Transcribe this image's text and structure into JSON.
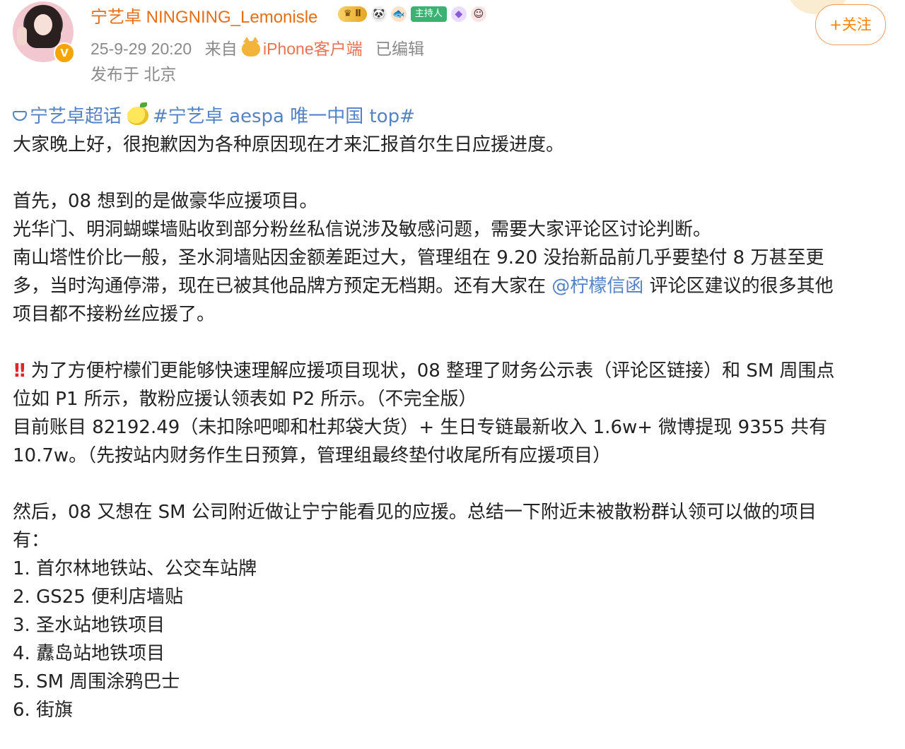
{
  "author": {
    "name": "宁艺卓 NINGNING_Lemonisle",
    "badges": {
      "crown_level": "Ⅱ",
      "host_label": "主持人"
    }
  },
  "post_meta": {
    "timestamp": "25-9-29 20:20",
    "source_prefix": "来自",
    "client": "iPhone客户端",
    "edited": "已编辑",
    "location": "发布于 北京"
  },
  "follow_button": {
    "label": "+关注"
  },
  "content": {
    "topic_super": "宁艺卓超话",
    "topic_tag": "#宁艺卓 aespa 唯一中国 top#",
    "line_1": "大家晚上好，很抱歉因为各种原因现在才来汇报首尔生日应援进度。",
    "para_2_line_1": "首先，08 想到的是做豪华应援项目。",
    "para_2_line_2": "光华门、明洞蝴蝶墙贴收到部分粉丝私信说涉及敏感问题，需要大家评论区讨论判断。",
    "para_2_line_3": "南山塔性价比一般，圣水洞墙贴因金额差距过大，管理组在 9.20 没抬新品前几乎要垫付 8 万甚至更",
    "para_2_line_4_a": "多，当时沟通停滞，现在已被其他品牌方预定无档期。还有大家在",
    "mention": "@柠檬信函",
    "para_2_line_4_b": "评论区建议的很多其他",
    "para_2_line_5": "项目都不接粉丝应援了。",
    "para_3_line_1": "为了方便柠檬们更能够快速理解应援项目现状，08 整理了财务公示表（评论区链接）和 SM 周围点",
    "para_3_line_2": "位如 P1 所示，散粉应援认领表如 P2 所示。（不完全版）",
    "para_3_line_3": "目前账目 82192.49（未扣除吧唧和杜邦袋大货）+ 生日专链最新收入 1.6w+ 微博提现 9355 共有",
    "para_3_line_4": "10.7w。（先按站内财务作生日预算，管理组最终垫付收尾所有应援项目）",
    "para_4_line_1": "然后，08 又想在 SM 公司附近做让宁宁能看见的应援。总结一下附近未被散粉群认领可以做的项目",
    "para_4_line_2": "有：",
    "items": [
      "1. 首尔林地铁站、公交车站牌",
      "2. GS25 便利店墙贴",
      "3. 圣水站地铁项目",
      "4. 纛岛站地铁项目",
      "5. SM 周围涂鸦巴士",
      "6. 街旗"
    ]
  }
}
